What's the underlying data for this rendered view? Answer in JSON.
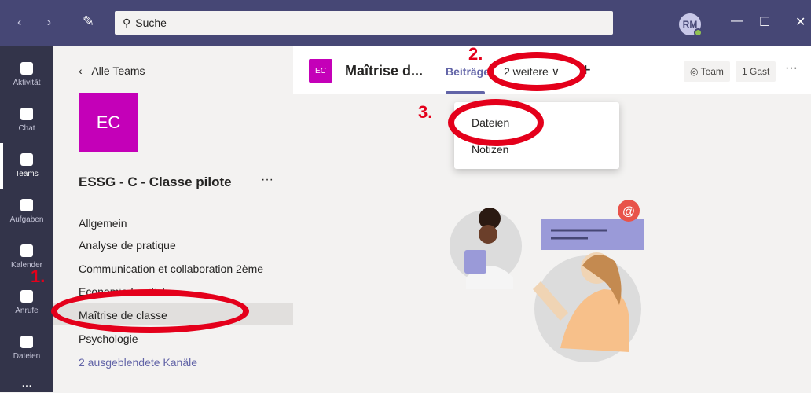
{
  "titlebar": {
    "search_placeholder": "Suche",
    "avatar_initials": "RM",
    "color": "#464775"
  },
  "rail": {
    "items": [
      {
        "label": "Aktivität",
        "icon": "bell-icon"
      },
      {
        "label": "Chat",
        "icon": "chat-icon"
      },
      {
        "label": "Teams",
        "icon": "teams-icon"
      },
      {
        "label": "Aufgaben",
        "icon": "assignments-icon"
      },
      {
        "label": "Kalender",
        "icon": "calendar-icon"
      },
      {
        "label": "Anrufe",
        "icon": "phone-icon"
      },
      {
        "label": "Dateien",
        "icon": "file-icon"
      }
    ],
    "more": "..."
  },
  "channels": {
    "back_label": "Alle Teams",
    "team_initials": "EC",
    "team_name": "ESSG - C - Classe pilote",
    "more": "···",
    "list": [
      "Allgemein",
      "Analyse de pratique",
      "Communication et collaboration 2ème",
      "Economie familiale",
      "Maîtrise de classe",
      "Psychologie"
    ],
    "hidden_link": "2 ausgeblendete Kanäle"
  },
  "header": {
    "tile_initials": "EC",
    "title": "Maîtrise d...",
    "tab_active": "Beiträge",
    "tab_more": "2 weitere ∨",
    "team_btn": "◎ Team",
    "guest_btn": "1 Gast",
    "more": "···"
  },
  "dropdown": {
    "items": [
      "Dateien",
      "Notizen"
    ]
  },
  "annotations": {
    "step1": "1.",
    "step2": "2.",
    "step3": "3.",
    "color": "#e4001b"
  }
}
